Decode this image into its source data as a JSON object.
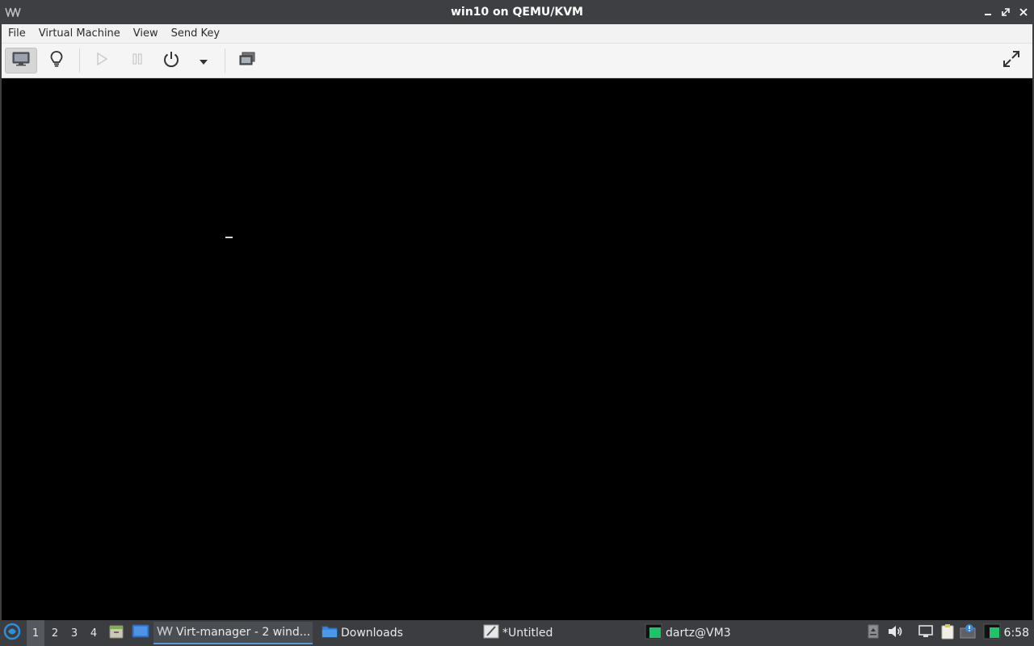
{
  "window": {
    "title": "win10 on QEMU/KVM"
  },
  "menubar": {
    "items": [
      "File",
      "Virtual Machine",
      "View",
      "Send Key"
    ]
  },
  "toolbar": {
    "buttons": [
      {
        "icon": "monitor-icon",
        "state": "active"
      },
      {
        "icon": "lightbulb-icon"
      },
      {
        "icon": "play-icon",
        "state": "disabled"
      },
      {
        "icon": "pause-icon",
        "state": "disabled"
      },
      {
        "icon": "power-icon"
      },
      {
        "icon": "chevron-down-icon"
      },
      {
        "icon": "snapshots-icon"
      },
      {
        "icon": "fullscreen-icon"
      }
    ]
  },
  "taskbar": {
    "workspaces": [
      "1",
      "2",
      "3",
      "4"
    ],
    "active_workspace": "1",
    "tasks": [
      {
        "label": "Virt-manager - 2 wind...",
        "icon": "virt-manager-icon",
        "active": true
      },
      {
        "label": "Downloads",
        "icon": "folder-icon"
      },
      {
        "label": "*Untitled",
        "icon": "text-editor-icon"
      },
      {
        "label": "dartz@VM3",
        "icon": "terminal-icon"
      }
    ],
    "clock": "6:58"
  },
  "colors": {
    "titlebar": "#3d3f42",
    "taskbar": "#3b3d40",
    "accent": "#5b9bd5",
    "display_bg": "#000000"
  }
}
